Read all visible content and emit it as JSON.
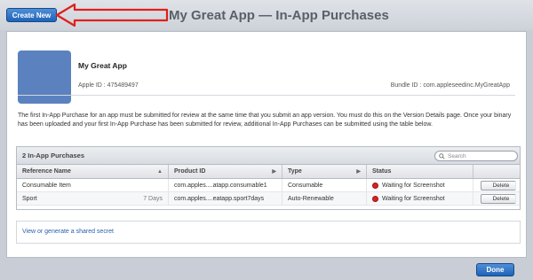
{
  "header": {
    "create_label": "Create New",
    "title": "My Great App — In-App Purchases"
  },
  "app": {
    "name": "My Great App",
    "apple_id": "Apple ID : 475489497",
    "bundle_id": "Bundle ID : com.appleseedinc.MyGreatApp"
  },
  "description": "The first In-App Purchase for an app must be submitted for review at the same time that you submit an app version. You must do this on the Version Details page. Once your binary has been uploaded and your first In-App Purchase has been submitted for review, additional In-App Purchases can be submitted using the table below.",
  "table": {
    "count_label": "2 In-App Purchases",
    "search_placeholder": "Search",
    "columns": [
      "Reference Name",
      "Product ID",
      "Type",
      "Status"
    ],
    "rows": [
      {
        "name": "Consumable Item",
        "duration": "",
        "product_id": "com.apples....atapp.consumable1",
        "type": "Consumable",
        "status": "Waiting for Screenshot",
        "action": "Delete"
      },
      {
        "name": "Sport",
        "duration": "7 Days",
        "product_id": "com.apples....eatapp.sport7days",
        "type": "Auto-Renewable",
        "status": "Waiting for Screenshot",
        "action": "Delete"
      }
    ]
  },
  "secret_link": "View or generate a shared secret",
  "footer": {
    "done_label": "Done"
  },
  "colors": {
    "accent": "#1f63b8",
    "status_red": "#d8241d",
    "arrow_red": "#e0201a"
  }
}
